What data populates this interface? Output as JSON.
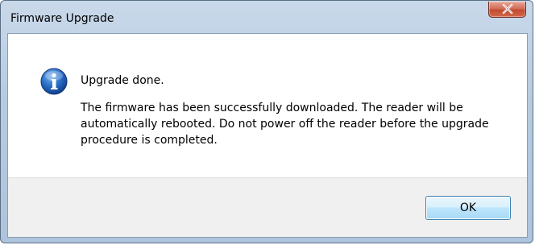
{
  "window": {
    "title": "Firmware Upgrade"
  },
  "dialog": {
    "icon": "info-icon",
    "main_instruction": "Upgrade done.",
    "body": "The firmware has been successfully downloaded. The reader will be automatically rebooted. Do not power off the reader before the upgrade procedure is completed."
  },
  "buttons": {
    "ok_label": "OK"
  },
  "colors": {
    "close_button": "#c24a2f",
    "info_icon": "#1a5fb4",
    "ok_border": "#3c7fb1"
  }
}
